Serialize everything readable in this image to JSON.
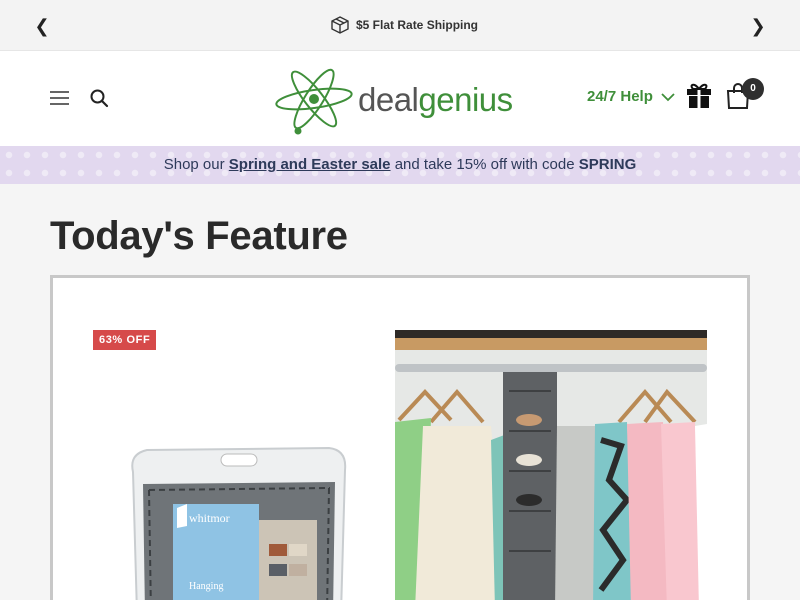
{
  "announcement": {
    "prev_icon": "chevron-left-icon",
    "next_icon": "chevron-right-icon",
    "prev_glyph": "❮",
    "next_glyph": "❯",
    "box_icon": "box-icon",
    "message": "$5 Flat Rate Shipping"
  },
  "header": {
    "menu_icon": "hamburger-icon",
    "search_icon": "search-icon",
    "logo": {
      "part1": "deal",
      "part2": "genius",
      "icon": "atom-logo-icon"
    },
    "help_label": "24/7 Help",
    "gift_icon": "gift-icon",
    "cart_icon": "shopping-bag-icon",
    "cart_count": "0"
  },
  "promo": {
    "prefix": "Shop our",
    "link": "Spring and Easter sale",
    "middle": "and take 15% off with code",
    "code": "SPRING"
  },
  "feature": {
    "title": "Today's Feature",
    "badge": "63% OFF",
    "product_brand": "whitmor",
    "product_text": "Hanging"
  },
  "colors": {
    "brand_green": "#3f8f3a",
    "promo_bg": "#e2d8ef",
    "badge_red": "#d64a4a"
  }
}
